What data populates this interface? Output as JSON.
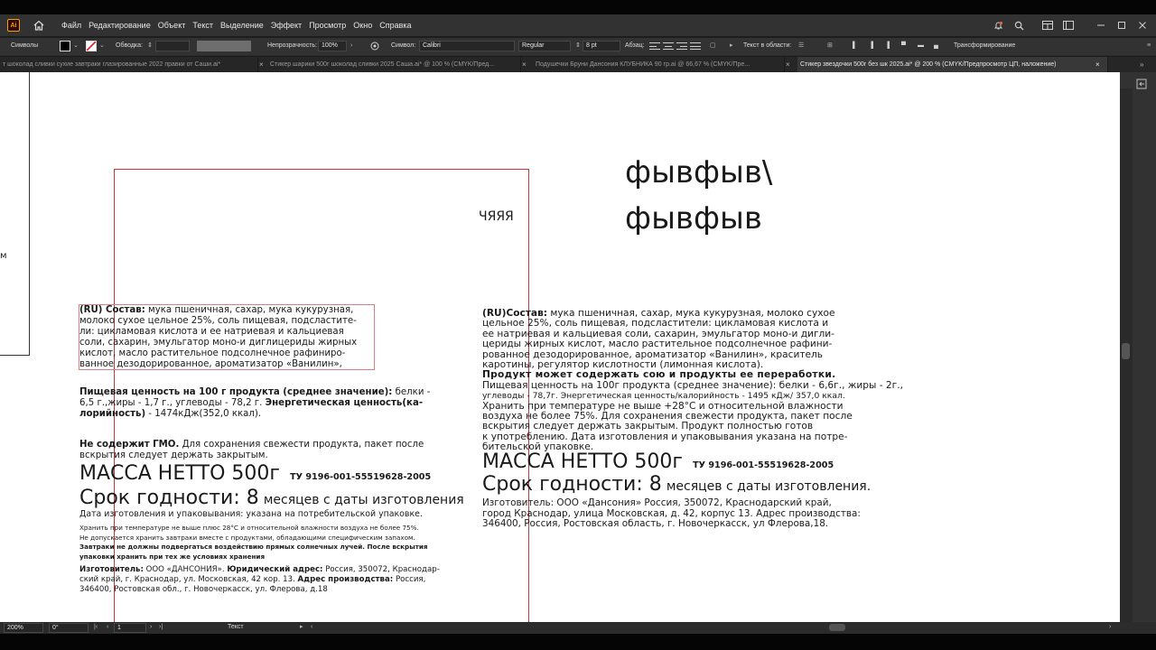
{
  "app": {
    "logo": "Ai"
  },
  "menubar": {
    "items": [
      "Файл",
      "Редактирование",
      "Объект",
      "Текст",
      "Выделение",
      "Эффект",
      "Просмотр",
      "Окно",
      "Справка"
    ]
  },
  "control_bar": {
    "panel_label": "Символы",
    "stroke_label": "Обводка:",
    "opacity_label": "Непрозрачность:",
    "opacity_value": "100%",
    "font_label": "Символ:",
    "font_value": "Calibri",
    "style_value": "Regular",
    "size_value": "8 pt",
    "paragraph_label": "Абзац:",
    "text_area_label": "Текст в области:",
    "transform_label": "Трансформирование"
  },
  "tabs": [
    {
      "label": "т шоколад сливки  сухие завтраки глазированные 2022 правки от Саши.ai*",
      "active": false
    },
    {
      "label": "Стикер шарики 500г шоколад сливки 2025 Саша.ai* @ 100 % (CMYK/Пред...",
      "active": false
    },
    {
      "label": "Подушечки Бруни Дансония КЛУБНИКА 90 гр.ai @ 66,67 % (CMYK/Пре...",
      "active": false
    },
    {
      "label": "Стикер звездочки 500г без шк 2025.ai* @ 200 % (CMYK/Предпросмотр ЦП, наложение)",
      "active": true
    }
  ],
  "tab_close": "×",
  "status": {
    "zoom": "200%",
    "angle": "0°",
    "artboard": "1",
    "mode": "Текст"
  },
  "canvas": {
    "edge_glyph": "м",
    "stray_text": "ЧЯЯЯ",
    "big_lines": [
      "фывфыв\\",
      "фывфыв"
    ],
    "left": {
      "composition_label": "(RU) Состав:",
      "composition_lines": [
        "  мука пшеничная, сахар, мука кукурузная,",
        "молоко сухое цельное  25%, соль пищевая, подсластите-",
        "ли: цикламовая кислота и ее натриевая и кальциевая",
        "соли, сахарин, эмульгатор моно-и диглицериды жирных",
        "кислот,  масло растительное  подсолнечное рафиниро-",
        "ванное  дезодорированное,  ароматизатор  «Ванилин»,"
      ],
      "nutrition_bold": "Пищевая ценность на 100 г продукта (среднее значение):",
      "nutrition_rest": " белки -",
      "nutrition_line2a": "6,5 г.,жиры - 1,7 г., углеводы - 78,2 г. ",
      "nutrition_line2b": "Энергетическая ценность(ка-",
      "nutrition_line3a": "лорийность)",
      "nutrition_line3b": " - 1474кДж(352,0 ккал).",
      "gmo_bold": "Не содержит  ГМО.",
      "gmo_rest": " Для сохранения свежести продукта, пакет после",
      "gmo_line2": "вскрытия следует держать закрытым.",
      "mass": "МАССА НЕТТО 500г",
      "tu": "ТУ 9196-001-55519628-2005",
      "shelf": "Срок годности: 8",
      "shelf_small": "месяцев с даты изготовления",
      "date_line": "Дата изготовления и упаковывания: указана на потребительской упаковке.",
      "storage_lines": [
        "Хранить при температуре не выше плюс 28°С и относительной влажности воздуха  не более 75%.",
        "Не допускается хранить завтраки вместе с продуктами, обладающими специфическим запахом."
      ],
      "warning_lines": [
        "Завтраки не должны подвергаться воздействию прямых солнечных лучей. После вскрытия",
        "упаковки хранить при тех же условиях хранения"
      ],
      "maker_bold": "Изготовитель:",
      "maker_text": " ООО «ДАНСОНИЯ». ",
      "legal_bold": "Юридический адрес:",
      "legal_text": " Россия, 350072, Краснодар-",
      "maker_line2a": "ский край, г. Краснодар, ул. Московская,  42 кор. 13. ",
      "prod_bold": "Адрес производства:",
      "prod_text": " Россия,",
      "maker_line3": "346400, Ростовская обл.,  г. Новочеркасск, ул. Флерова, д.18"
    },
    "right": {
      "composition_label": "(RU)Состав:",
      "composition_first": " мука пшеничная, сахар, мука кукурузная, молоко сухое",
      "composition_lines": [
        "цельное  25%, соль пищевая, подсластители: цикламовая кислота и",
        "ее натриевая и кальциевая соли, сахарин, эмульгатор моно-и дигли-",
        "цериды жирных кислот, масло растительное подсолнечное рафини-",
        "рованное дезодорированное, ароматизатор «Ванилин», краситель",
        "каротины, регулятор кислотности (лимонная кислота)."
      ],
      "soy_line": "Продукт может содержать сою и продукты ее переработки.",
      "nutrition_line1": "Пищевая ценность на 100г продукта (среднее значение): белки - 6,6г., жиры - 2г.,",
      "nutrition_line2": "углеводы - 78,7г. Энергетическая ценность/калорийность - 1495 кДж/ 357,0 ккал.",
      "storage_lines": [
        "Хранить при температуре не выше +28°С и относительной влажности",
        "воздуха не более 75%. Для сохранения свежести продукта, пакет после",
        "вскрытия следует держать закрытым. Продукт полностью готов",
        "к употреблению. Дата изготовления и упаковывания указана на потре-",
        "бительской упаковке."
      ],
      "mass": "МАССА НЕТТО 500г",
      "tu": "ТУ 9196-001-55519628-2005",
      "shelf": "Срок годности: 8",
      "shelf_small": "месяцев с даты изготовления.",
      "maker_lines": [
        "Изготовитель: ООО «Дансония» Россия, 350072, Краснодарский край,",
        "город Краснодар, улица Московская, д. 42, корпус 13. Адрес производства:",
        "346400, Россия, Ростовская область, г. Новочеркасск, ул Флерова,18."
      ]
    }
  }
}
